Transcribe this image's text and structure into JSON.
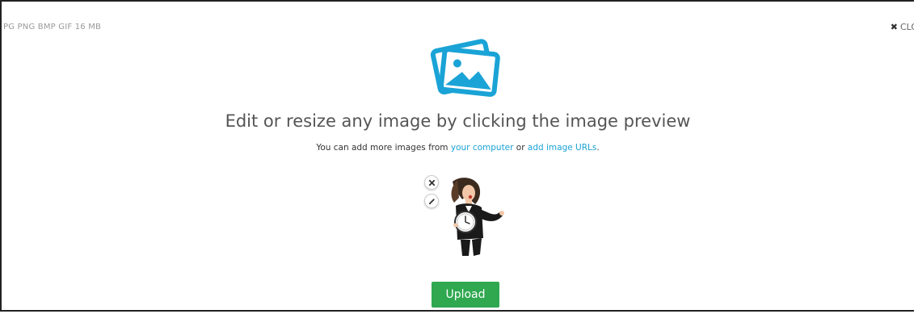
{
  "header": {
    "formats_text": "PG PNG BMP GIF  16 MB",
    "close_label": "CLOS",
    "close_icon": "close-icon"
  },
  "main": {
    "hero_icon": "images-icon",
    "headline": "Edit or resize any image by clicking the image preview",
    "sub_prefix": "You can add more images from ",
    "sub_link_computer": "your computer",
    "sub_middle": " or ",
    "sub_link_urls": "add image URLs",
    "sub_suffix": "."
  },
  "thumbnail": {
    "remove_icon": "remove-icon",
    "edit_icon": "pencil-icon",
    "preview_alt": "woman holding clock"
  },
  "actions": {
    "upload_label": "Upload"
  },
  "colors": {
    "accent_blue": "#1aa3d6",
    "upload_green": "#2fa84f"
  }
}
